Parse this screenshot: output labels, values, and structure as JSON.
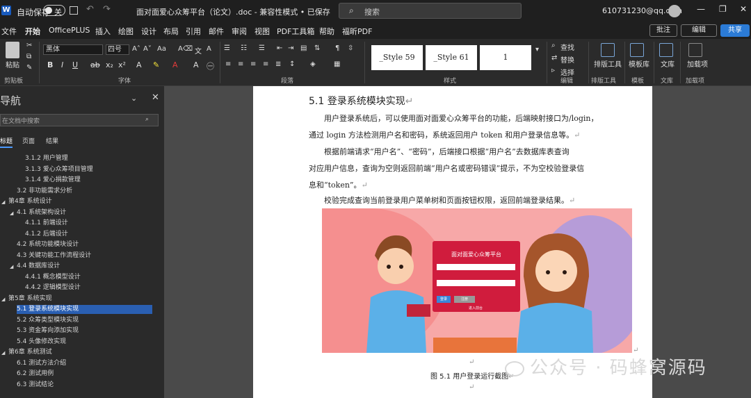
{
  "titlebar": {
    "app_logo": "W",
    "autosave_label": "自动保存",
    "autosave_state": "关",
    "doc_title": "面对面爱心众筹平台（论文）.doc  -  兼容性模式 • 已保存",
    "search_placeholder": "搜索",
    "account": "610731230@qq.com",
    "icons": [
      "word-icon",
      "save-icon",
      "undo-icon",
      "redo-icon",
      "search-icon",
      "avatar-icon",
      "minimize-icon",
      "maximize-icon",
      "close-icon"
    ]
  },
  "menu": {
    "tabs": [
      "文件",
      "开始",
      "OfficePLUS",
      "插入",
      "绘图",
      "设计",
      "布局",
      "引用",
      "邮件",
      "审阅",
      "视图",
      "PDF工具箱",
      "帮助",
      "福昕PDF"
    ],
    "active": "开始",
    "comment": "批注",
    "edit": "编辑",
    "share": "共享"
  },
  "ribbon": {
    "paste": "粘贴",
    "font_name": "黑体",
    "font_size": "四号",
    "group_clipboard": "剪贴板",
    "group_font": "字体",
    "group_paragraph": "段落",
    "group_styles": "样式",
    "group_edit": "编辑",
    "group_layout_tool": "排版工具",
    "group_template": "模板",
    "group_library": "文库",
    "group_addin": "加载项",
    "styles": [
      "_Style 59",
      "_Style 61",
      "1"
    ],
    "find": "查找",
    "replace": "替换",
    "select": "选择",
    "layout_tool": "排版工具",
    "template_lib": "模板库",
    "library": "文库",
    "addin": "加载项"
  },
  "nav": {
    "title": "导航",
    "search_placeholder": "在文档中搜索",
    "tabs": [
      "标题",
      "页面",
      "结果"
    ],
    "headings": [
      {
        "level": 3,
        "text": "3.1.2  用户管理"
      },
      {
        "level": 3,
        "text": "3.1.3  爱心众筹项目管理"
      },
      {
        "level": 3,
        "text": "3.1.4  爱心捐款管理"
      },
      {
        "level": 2,
        "text": "3.2  非功能需求分析"
      },
      {
        "level": 1,
        "text": "第4章  系统设计"
      },
      {
        "level": 2,
        "text": "4.1  系统架构设计"
      },
      {
        "level": 3,
        "text": "4.1.1  前端设计"
      },
      {
        "level": 3,
        "text": "4.1.2  后端设计"
      },
      {
        "level": 2,
        "text": "4.2  系统功能模块设计"
      },
      {
        "level": 2,
        "text": "4.3  关键功能工作流程设计"
      },
      {
        "level": 2,
        "text": "4.4  数据库设计"
      },
      {
        "level": 3,
        "text": "4.4.1  概念模型设计"
      },
      {
        "level": 3,
        "text": "4.4.2  逻辑模型设计"
      },
      {
        "level": 1,
        "text": "第5章  系统实现"
      },
      {
        "level": 2,
        "text": "5.1  登录系统模块实现"
      },
      {
        "level": 2,
        "text": "5.2  众筹类型模块实现"
      },
      {
        "level": 2,
        "text": "5.3  资金筹向添加实现"
      },
      {
        "level": 2,
        "text": "5.4  头像修改实现"
      },
      {
        "level": 1,
        "text": "第6章  系统测试"
      },
      {
        "level": 2,
        "text": "6.1  测试方法介绍"
      },
      {
        "level": 2,
        "text": "6.2  测试用例"
      },
      {
        "level": 2,
        "text": "6.3  测试结论"
      }
    ],
    "selected_index": 14
  },
  "doc": {
    "heading": "5.1   登录系统模块实现",
    "para1_line1": "用户登录系统后，可以使用面对面爱心众筹平台的功能，后端映射接口为/login，",
    "para1_line2": "通过 login 方法检测用户名和密码，系统返回用户 token 和用户登录信息等。",
    "para2_line1": "根据前端请求“用户名”、“密码”，后端接口根据“用户名”去数据库表查询",
    "para2_line2": "对应用户信息，查询为空则返回前端“用户名或密码错误”提示，不为空校验登录信",
    "para2_line3": "息和“token”。",
    "para3": "校验完成查询当前登录用户菜单树和页面按钮权限，返回前端登录结果。",
    "login_card_title": "面对面爱心众筹平台",
    "btn_login": "登录",
    "btn_reset": "注册",
    "login_link": "进入前台",
    "caption": "图 5.1  用户登录运行截图"
  },
  "watermark": "公众号 · 码蜂窝源码"
}
